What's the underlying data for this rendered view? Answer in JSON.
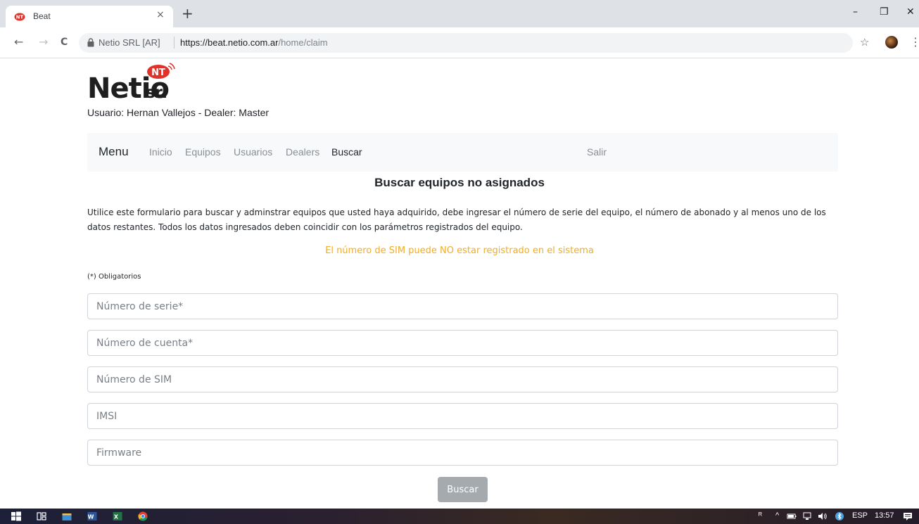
{
  "browser": {
    "tab_title": "Beat",
    "tab_close": "×",
    "new_tab": "+",
    "window_controls": {
      "minimize": "–",
      "restore": "❐",
      "close": "✕"
    },
    "nav": {
      "back": "←",
      "forward": "→",
      "reload": "C"
    },
    "site_name": "Netio SRL [AR]",
    "url_host": "https://beat.netio.com.ar",
    "url_path": "/home/claim",
    "bookmark_icon": "star-icon",
    "menu_icon": "⋮"
  },
  "header": {
    "logo_text": "Netio",
    "logo_suffix": "srl",
    "logo_badge": "NT",
    "user_line": "Usuario: Hernan Vallejos - Dealer: Master"
  },
  "navbar": {
    "brand": "Menu",
    "links": [
      "Inicio",
      "Equipos",
      "Usuarios",
      "Dealers",
      "Buscar"
    ],
    "active": "Buscar",
    "logout": "Salir"
  },
  "main": {
    "title": "Buscar equipos no asignados",
    "intro": "Utilice este formulario para buscar y adminstrar equipos que usted haya adquirido, debe ingresar el número de serie del equipo, el número de abonado y al menos uno de los datos restantes. Todos los datos ingresados deben coincidir con los parámetros registrados del equipo.",
    "warning": "El número de SIM puede NO estar registrado en el sistema",
    "required_note": "(*) Obligatorios",
    "fields": {
      "serial": {
        "placeholder": "Número de serie*",
        "value": ""
      },
      "account": {
        "placeholder": "Número de cuenta*",
        "value": ""
      },
      "sim": {
        "placeholder": "Número de SIM",
        "value": ""
      },
      "imsi": {
        "placeholder": "IMSI",
        "value": ""
      },
      "firmware": {
        "placeholder": "Firmware",
        "value": ""
      }
    },
    "submit_label": "Buscar"
  },
  "taskbar": {
    "apps": [
      "windows-start-icon",
      "task-view-icon",
      "file-explorer-icon",
      "word-icon",
      "excel-icon",
      "chrome-icon"
    ],
    "language": "ESP",
    "time": "13:57"
  },
  "colors": {
    "warning": "#f0ad28",
    "navbar_bg": "#f8f9fa",
    "button_bg": "#a5aaaf",
    "logo_red": "#e0322a"
  }
}
